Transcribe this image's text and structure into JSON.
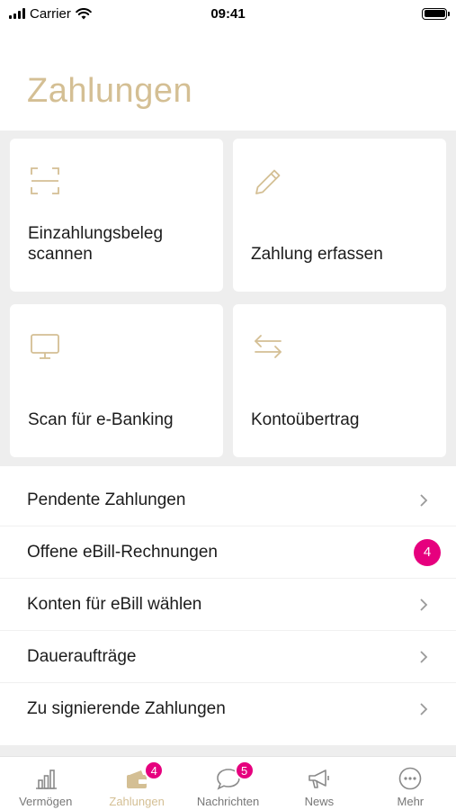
{
  "status_bar": {
    "carrier": "Carrier",
    "time": "09:41"
  },
  "page": {
    "title": "Zahlungen"
  },
  "tiles": [
    {
      "label": "Einzahlungsbeleg scannen",
      "icon": "scan-icon"
    },
    {
      "label": "Zahlung erfassen",
      "icon": "pencil-icon"
    },
    {
      "label": "Scan für e-Banking",
      "icon": "monitor-icon"
    },
    {
      "label": "Kontoübertrag",
      "icon": "transfer-arrows-icon"
    }
  ],
  "list": [
    {
      "label": "Pendente Zahlungen"
    },
    {
      "label": "Offene eBill-Rechnungen",
      "badge": "4"
    },
    {
      "label": "Konten für eBill wählen"
    },
    {
      "label": "Daueraufträge"
    },
    {
      "label": "Zu signierende Zahlungen"
    }
  ],
  "tabs": [
    {
      "label": "Vermögen",
      "icon": "bar-chart-icon"
    },
    {
      "label": "Zahlungen",
      "icon": "wallet-icon",
      "badge": "4",
      "active": true
    },
    {
      "label": "Nachrichten",
      "icon": "chat-bubble-icon",
      "badge": "5"
    },
    {
      "label": "News",
      "icon": "megaphone-icon"
    },
    {
      "label": "Mehr",
      "icon": "more-dots-icon"
    }
  ],
  "colors": {
    "accent": "#d4bf94",
    "badge": "#e6007e",
    "background_gray": "#eeeeee"
  }
}
